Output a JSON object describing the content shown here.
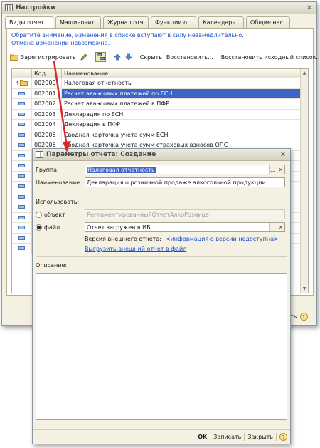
{
  "colors": {
    "accent": "#3c65c5",
    "link": "#2050c8",
    "arrow": "#d62828"
  },
  "bg_window": {
    "title": "Настройки",
    "tabs": [
      "Виды отчет...",
      "Машиночит...",
      "Журнал отч...",
      "Функции о...",
      "Календарь ...",
      "Общие нас..."
    ],
    "notice_line1": "Обратите внимание, изменения в списке вступают в силу незамедлительно.",
    "notice_line2": "Отмена изменений невозможна.",
    "toolbar": {
      "register": "Зарегистрировать",
      "hide": "Скрыть",
      "restore": "Восстановить...",
      "restore_original": "Восстановить исходный список..."
    },
    "grid": {
      "col_code": "Код",
      "col_name": "Наименование",
      "rows": [
        {
          "code": "002000",
          "name": "Налоговая отчетность",
          "icon": "folder-icon"
        },
        {
          "code": "002001",
          "name": "Расчет авансовых платежей по ЕСН",
          "icon": "item-icon"
        },
        {
          "code": "002002",
          "name": "Расчет авансовых платежей в ПФР",
          "icon": "item-icon"
        },
        {
          "code": "002003",
          "name": "Декларация по ЕСН",
          "icon": "item-icon"
        },
        {
          "code": "002004",
          "name": "Декларация в ПФР",
          "icon": "item-icon"
        },
        {
          "code": "002005",
          "name": "Сводная карточка учета сумм ЕСН",
          "icon": "item-icon"
        },
        {
          "code": "002006",
          "name": "Сводная карточка учета сумм страховых взносов ОПС",
          "icon": "item-icon"
        }
      ]
    },
    "bottom_close": "ить"
  },
  "fg_window": {
    "title": "Параметры отчета: Создание",
    "group_label": "Группа:",
    "group_value": "Налоговая отчетность",
    "name_label": "Наименование:",
    "name_value": "Декларация о розничной продаже алкогольной продукции",
    "use_label": "Использовать:",
    "radio_object": "объект",
    "object_value": "РегламентированныйОтчетАлкоРозница",
    "radio_file": "файл",
    "file_value": "Отчет загружен в ИБ",
    "version_label": "Версия внешнего отчета:",
    "version_value": "<информация о версии недоступна>",
    "export_link": "Выгрузить внешний отчет в файл",
    "description_label": "Описание:",
    "buttons": {
      "ok": "OK",
      "save": "Записать",
      "close": "Закрыть"
    }
  }
}
